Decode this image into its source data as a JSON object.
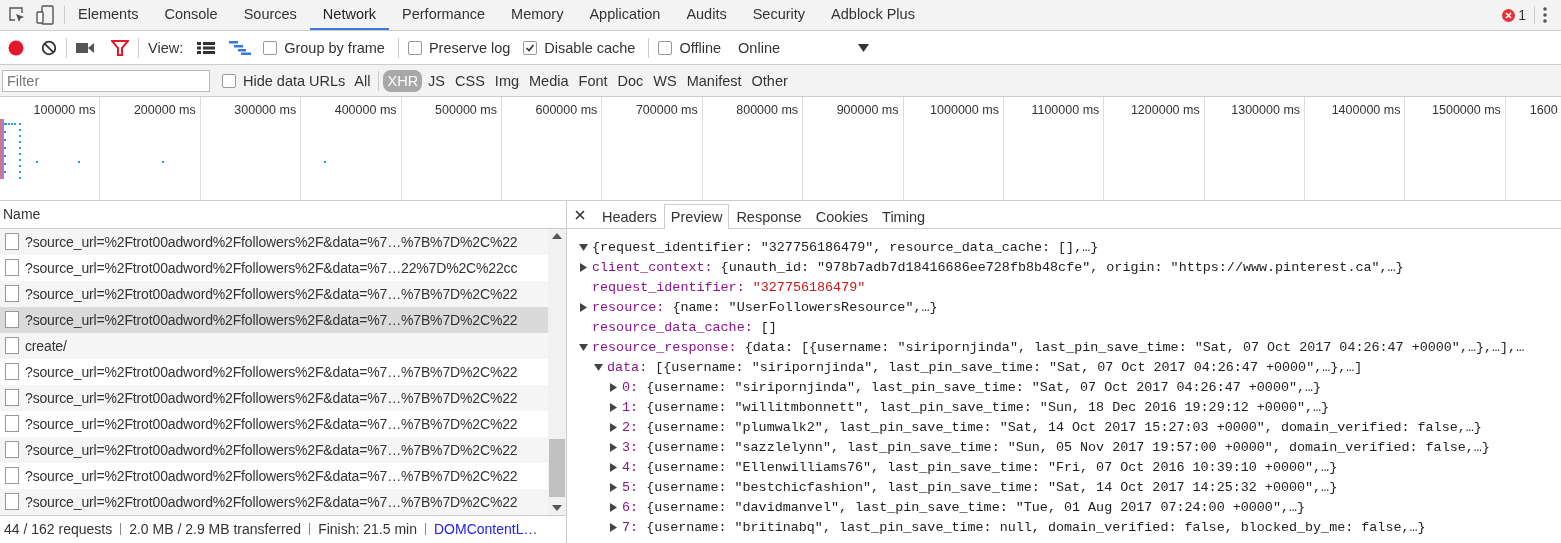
{
  "devtools_tabs": [
    {
      "label": "Elements",
      "selected": false
    },
    {
      "label": "Console",
      "selected": false
    },
    {
      "label": "Sources",
      "selected": false
    },
    {
      "label": "Network",
      "selected": true
    },
    {
      "label": "Performance",
      "selected": false
    },
    {
      "label": "Memory",
      "selected": false
    },
    {
      "label": "Application",
      "selected": false
    },
    {
      "label": "Audits",
      "selected": false
    },
    {
      "label": "Security",
      "selected": false
    },
    {
      "label": "Adblock Plus",
      "selected": false
    }
  ],
  "error_count": "1",
  "toolbar": {
    "recording": true,
    "filter_active": true,
    "view_label": "View:",
    "checkbox_groups": [
      [
        {
          "label": "Group by frame",
          "checked": false
        }
      ],
      [
        {
          "label": "Preserve log",
          "checked": false
        },
        {
          "label": "Disable cache",
          "checked": true
        }
      ],
      [
        {
          "label": "Offline",
          "checked": false
        }
      ]
    ],
    "throttling": "Online"
  },
  "filter_bar": {
    "placeholder": "Filter",
    "hide_data_urls": {
      "label": "Hide data URLs",
      "checked": false
    },
    "types": [
      {
        "label": "All",
        "selected": false
      },
      {
        "label": "XHR",
        "selected": true
      },
      {
        "label": "JS",
        "selected": false
      },
      {
        "label": "CSS",
        "selected": false
      },
      {
        "label": "Img",
        "selected": false
      },
      {
        "label": "Media",
        "selected": false
      },
      {
        "label": "Font",
        "selected": false
      },
      {
        "label": "Doc",
        "selected": false
      },
      {
        "label": "WS",
        "selected": false
      },
      {
        "label": "Manifest",
        "selected": false
      },
      {
        "label": "Other",
        "selected": false
      }
    ]
  },
  "overview": {
    "ticks": [
      "100000 ms",
      "200000 ms",
      "300000 ms",
      "400000 ms",
      "500000 ms",
      "600000 ms",
      "700000 ms",
      "800000 ms",
      "900000 ms",
      "1000000 ms",
      "1100000 ms",
      "1200000 ms",
      "1300000 ms",
      "1400000 ms",
      "1500000 ms",
      "1600"
    ]
  },
  "requests": {
    "column": "Name",
    "rows": [
      {
        "name": "?source_url=%2Ftrot00adword%2Ffollowers%2F&data=%7…%7B%7D%2C%22",
        "selected": false
      },
      {
        "name": "?source_url=%2Ftrot00adword%2Ffollowers%2F&data=%7…22%7D%2C%22cc",
        "selected": false
      },
      {
        "name": "?source_url=%2Ftrot00adword%2Ffollowers%2F&data=%7…%7B%7D%2C%22",
        "selected": false
      },
      {
        "name": "?source_url=%2Ftrot00adword%2Ffollowers%2F&data=%7…%7B%7D%2C%22",
        "selected": true
      },
      {
        "name": "create/",
        "selected": false
      },
      {
        "name": "?source_url=%2Ftrot00adword%2Ffollowers%2F&data=%7…%7B%7D%2C%22",
        "selected": false
      },
      {
        "name": "?source_url=%2Ftrot00adword%2Ffollowers%2F&data=%7…%7B%7D%2C%22",
        "selected": false
      },
      {
        "name": "?source_url=%2Ftrot00adword%2Ffollowers%2F&data=%7…%7B%7D%2C%22",
        "selected": false
      },
      {
        "name": "?source_url=%2Ftrot00adword%2Ffollowers%2F&data=%7…%7B%7D%2C%22",
        "selected": false
      },
      {
        "name": "?source_url=%2Ftrot00adword%2Ffollowers%2F&data=%7…%7B%7D%2C%22",
        "selected": false
      },
      {
        "name": "?source_url=%2Ftrot00adword%2Ffollowers%2F&data=%7…%7B%7D%2C%22",
        "selected": false
      }
    ]
  },
  "status_bar": {
    "items": [
      "44 / 162 requests",
      "2.0 MB / 2.9 MB transferred",
      "Finish: 21.5 min"
    ],
    "dom_content_loaded": "DOMContentL…"
  },
  "detail_tabs": [
    {
      "label": "Headers",
      "selected": false
    },
    {
      "label": "Preview",
      "selected": true
    },
    {
      "label": "Response",
      "selected": false
    },
    {
      "label": "Cookies",
      "selected": false
    },
    {
      "label": "Timing",
      "selected": false
    }
  ],
  "preview": {
    "summary": "{request_identifier: \"327756186479\", resource_data_cache: [],…}",
    "expanded": true,
    "children": [
      {
        "key": "client_context:",
        "value": "{unauth_id: \"978b7adb7d18416686ee728fb8b48cfe\", origin: \"https://www.pinterest.ca\",…}",
        "expanded": false
      },
      {
        "key": "request_identifier:",
        "value": "\"327756186479\"",
        "kind": "string"
      },
      {
        "key": "resource:",
        "value": "{name: \"UserFollowersResource\",…}",
        "expanded": false
      },
      {
        "key": "resource_data_cache:",
        "value": "[]",
        "kind": "literal"
      },
      {
        "key": "resource_response:",
        "value": "{data: [{username: \"siripornjinda\", last_pin_save_time: \"Sat, 07 Oct 2017 04:26:47 +0000\",…},…],…",
        "expanded": true,
        "children": [
          {
            "key": "data:",
            "value": "[{username: \"siripornjinda\", last_pin_save_time: \"Sat, 07 Oct 2017 04:26:47 +0000\",…},…]",
            "expanded": true,
            "children": [
              {
                "key": "0:",
                "value": "{username: \"siripornjinda\", last_pin_save_time: \"Sat, 07 Oct 2017 04:26:47 +0000\",…}",
                "expanded": false
              },
              {
                "key": "1:",
                "value": "{username: \"willitmbonnett\", last_pin_save_time: \"Sun, 18 Dec 2016 19:29:12 +0000\",…}",
                "expanded": false
              },
              {
                "key": "2:",
                "value": "{username: \"plumwalk2\", last_pin_save_time: \"Sat, 14 Oct 2017 15:27:03 +0000\", domain_verified: false,…}",
                "expanded": false
              },
              {
                "key": "3:",
                "value": "{username: \"sazzlelynn\", last_pin_save_time: \"Sun, 05 Nov 2017 19:57:00 +0000\", domain_verified: false,…}",
                "expanded": false
              },
              {
                "key": "4:",
                "value": "{username: \"Ellenwilliams76\", last_pin_save_time: \"Fri, 07 Oct 2016 10:39:10 +0000\",…}",
                "expanded": false
              },
              {
                "key": "5:",
                "value": "{username: \"bestchicfashion\", last_pin_save_time: \"Sat, 14 Oct 2017 14:25:32 +0000\",…}",
                "expanded": false
              },
              {
                "key": "6:",
                "value": "{username: \"davidmanvel\", last_pin_save_time: \"Tue, 01 Aug 2017 07:24:00 +0000\",…}",
                "expanded": false
              },
              {
                "key": "7:",
                "value": "{username: \"britinabq\", last_pin_save_time: null, domain_verified: false, blocked_by_me: false,…}",
                "expanded": false
              }
            ]
          }
        ]
      }
    ]
  }
}
